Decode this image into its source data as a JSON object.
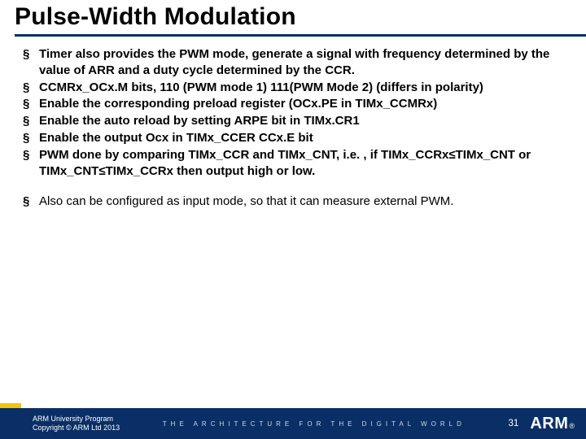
{
  "title": "Pulse-Width Modulation",
  "bullets_a": [
    "Timer also provides the PWM mode, generate a signal with frequency determined by the value of ARR and a duty cycle determined by the CCR.",
    "CCMRx_OCx.M bits, 110 (PWM mode 1) 111(PWM Mode 2) (differs in polarity)",
    "Enable the corresponding preload register (OCx.PE in TIMx_CCMRx)",
    "Enable the auto reload by setting ARPE bit in TIMx.CR1",
    "Enable the output Ocx in TIMx_CCER CCx.E bit",
    "PWM done by comparing TIMx_CCR and TIMx_CNT, i.e. , if TIMx_CCRx≤TIMx_CNT or TIMx_CNT≤TIMx_CCRx then output high or low."
  ],
  "bullets_b": [
    "Also can be configured as input mode, so that it can measure external PWM."
  ],
  "footer": {
    "line1": "ARM University Program",
    "line2": "Copyright © ARM Ltd 2013",
    "tagline": "THE ARCHITECTURE FOR THE DIGITAL WORLD",
    "pagenum": "31",
    "logo_text": "ARM",
    "logo_reg": "®"
  }
}
